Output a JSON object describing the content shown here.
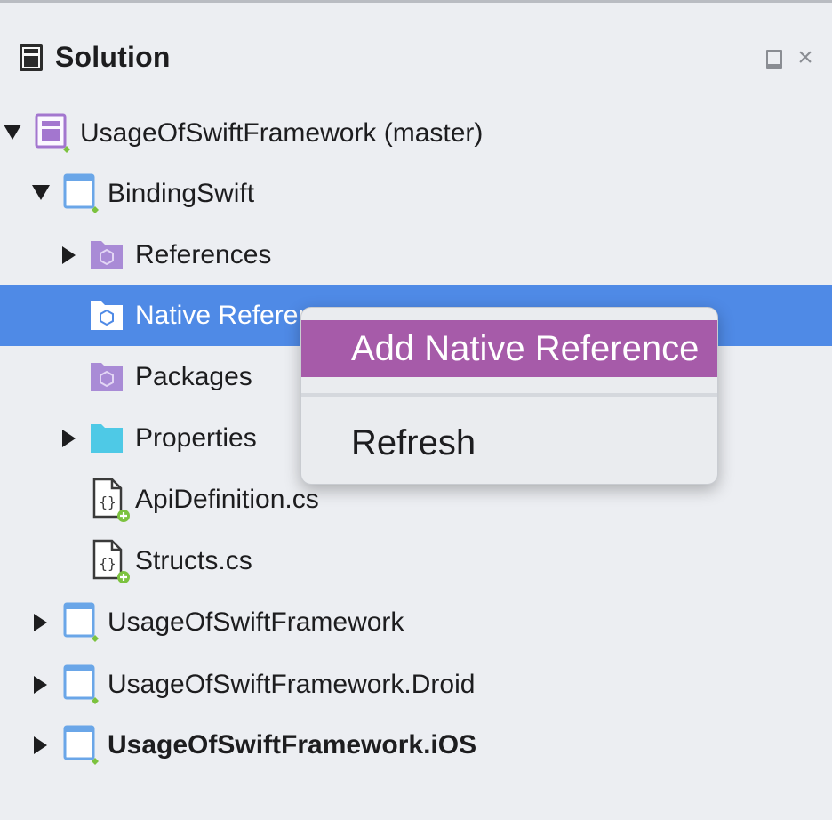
{
  "pad": {
    "title": "Solution",
    "dock_icon": "dock-icon",
    "close_icon": "close-icon",
    "close_glyph": "×"
  },
  "tree": {
    "solution": {
      "label": "UsageOfSwiftFramework (master)",
      "icon": "solution-icon",
      "expanded": true
    },
    "project_binding": {
      "label": "BindingSwift",
      "icon": "project-icon",
      "expanded": true
    },
    "references": {
      "label": "References",
      "icon": "references-folder-icon",
      "expanded": false
    },
    "native_references": {
      "label": "Native References",
      "icon": "native-references-folder-icon",
      "selected": true
    },
    "packages": {
      "label": "Packages",
      "icon": "packages-folder-icon"
    },
    "properties": {
      "label": "Properties",
      "icon": "folder-icon",
      "expanded": false
    },
    "api_definition": {
      "label": "ApiDefinition.cs",
      "icon": "csharp-file-icon"
    },
    "structs": {
      "label": "Structs.cs",
      "icon": "csharp-file-icon"
    },
    "project_usage": {
      "label": "UsageOfSwiftFramework",
      "icon": "project-icon",
      "expanded": false
    },
    "project_droid": {
      "label": "UsageOfSwiftFramework.Droid",
      "icon": "project-icon",
      "expanded": false
    },
    "project_ios": {
      "label": "UsageOfSwiftFramework.iOS",
      "icon": "project-icon",
      "expanded": false,
      "startup": true
    }
  },
  "context_menu": {
    "items": [
      {
        "label": "Add Native Reference",
        "highlighted": true
      },
      {
        "label": "Refresh",
        "highlighted": false
      }
    ]
  },
  "colors": {
    "selection": "#4f8ae6",
    "menu_highlight": "#a65ba9",
    "project_icon_blue": "#6aa6e8",
    "solution_icon_purple": "#a376cf",
    "folder_purple": "#a98bd6",
    "folder_cyan": "#4ec9e6",
    "status_green": "#7cc23f"
  }
}
